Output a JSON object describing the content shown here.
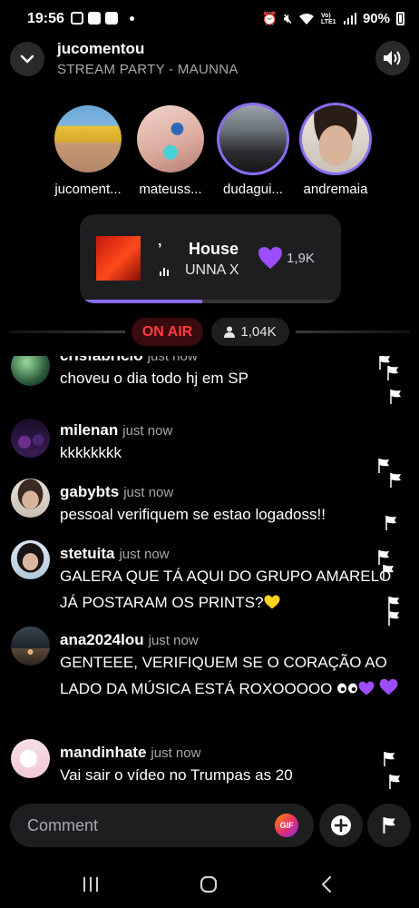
{
  "status_bar": {
    "time": "19:56",
    "network": "Vo) LTE1",
    "battery": "90%"
  },
  "header": {
    "title": "jucomentou",
    "subtitle": "STREAM PARTY - MAUNNA"
  },
  "participants": [
    {
      "name": "jucoment...",
      "highlighted": false
    },
    {
      "name": "mateuss...",
      "highlighted": false
    },
    {
      "name": "dudagui...",
      "highlighted": true
    },
    {
      "name": "andremaia",
      "highlighted": true
    }
  ],
  "now_playing": {
    "scrolling_fragment": "’",
    "track": "House",
    "artist": "UNNA X",
    "likes": "1,9K",
    "progress": 0.47
  },
  "live": {
    "on_air_label": "ON AIR",
    "viewers": "1,04K"
  },
  "comments": [
    {
      "user": "crisfabricio",
      "time": "just now",
      "text": "choveu o dia todo hj em SP"
    },
    {
      "user": "milenan",
      "time": "just now",
      "text": "kkkkkkkk"
    },
    {
      "user": "gabybts",
      "time": "just now",
      "text": "pessoal verifiquem se estao logadoss!!"
    },
    {
      "user": "stetuita",
      "time": "just now",
      "text": "GALERA QUE TÁ AQUI DO GRUPO AMARELO JÁ POSTARAM OS PRINTS?"
    },
    {
      "user": "ana2024lou",
      "time": "just now",
      "text": "GENTEEE, VERIFIQUEM SE O CORAÇÃO AO LADO DA MÚSICA ESTÁ ROXOOOOO"
    },
    {
      "user": "mandinhate",
      "time": "just now",
      "text": "Vai sair o vídeo no Trumpas as 20"
    }
  ],
  "composer": {
    "placeholder": "Comment",
    "gif_label": "GIF"
  },
  "colors": {
    "accent_purple": "#8a6cf0",
    "heart_purple": "#9b4dff",
    "on_air_red": "#ff3b3b",
    "yellow_heart": "#ffd21f"
  },
  "icons": [
    "chevron-down-icon",
    "volume-icon",
    "heart-icon",
    "person-icon",
    "flag-icon",
    "plus-icon",
    "gif-icon",
    "recents-icon",
    "home-icon",
    "back-icon"
  ]
}
